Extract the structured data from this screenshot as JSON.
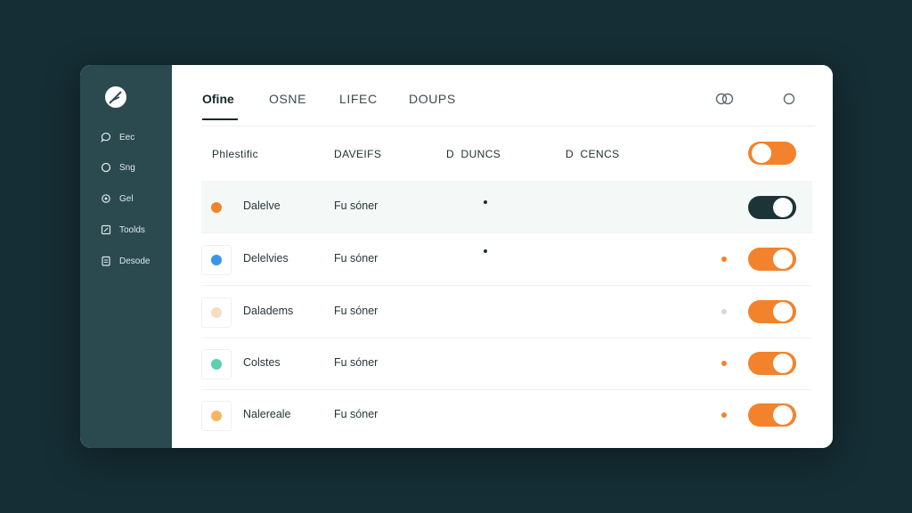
{
  "colors": {
    "accent": "#f2832c",
    "sidebar": "#2b4a50",
    "dark_toggle": "#1c3338"
  },
  "sidebar": {
    "logo_icon": "feather-icon",
    "items": [
      {
        "label": "Eec",
        "icon": "chat-icon"
      },
      {
        "label": "Sng",
        "icon": "circle-icon"
      },
      {
        "label": "Gel",
        "icon": "gear-icon"
      },
      {
        "label": "Toolds",
        "icon": "edit-icon"
      },
      {
        "label": "Desode",
        "icon": "document-icon"
      }
    ]
  },
  "tabs": [
    {
      "label": "Ofine",
      "active": true
    },
    {
      "label": "OSNE",
      "active": false
    },
    {
      "label": "LIFEC",
      "active": false
    },
    {
      "label": "DOUPS",
      "active": false
    }
  ],
  "top_controls": {
    "left_icon": "view-toggle-icon",
    "right_icon": "circle-icon"
  },
  "columns": [
    "Phlestific",
    "DAVEIFS",
    "D  DUNCS",
    "D  CENCS"
  ],
  "header_toggle": {
    "on": true
  },
  "rows": [
    {
      "name": "Dalelve",
      "meta": "Fu sóner",
      "dot_color": "#f2832c",
      "status_color": "",
      "toggle_on": true,
      "toggle_color": "#1c3338",
      "highlight": true
    },
    {
      "name": "Delelvies",
      "meta": "Fu sóner",
      "dot_color": "#3b97e6",
      "status_color": "#f2832c",
      "toggle_on": true,
      "toggle_color": "#f2832c",
      "highlight": false
    },
    {
      "name": "Daladems",
      "meta": "Fu sóner",
      "dot_color": "#f6dcc2",
      "status_color": "#d5d8d8",
      "toggle_on": true,
      "toggle_color": "#f2832c",
      "highlight": false
    },
    {
      "name": "Colstes",
      "meta": "Fu sóner",
      "dot_color": "#5fcfae",
      "status_color": "#f2832c",
      "toggle_on": true,
      "toggle_color": "#f2832c",
      "highlight": false
    },
    {
      "name": "Nalereale",
      "meta": "Fu sóner",
      "dot_color": "#f5b65f",
      "status_color": "#f2832c",
      "toggle_on": true,
      "toggle_color": "#f2832c",
      "highlight": false
    }
  ]
}
